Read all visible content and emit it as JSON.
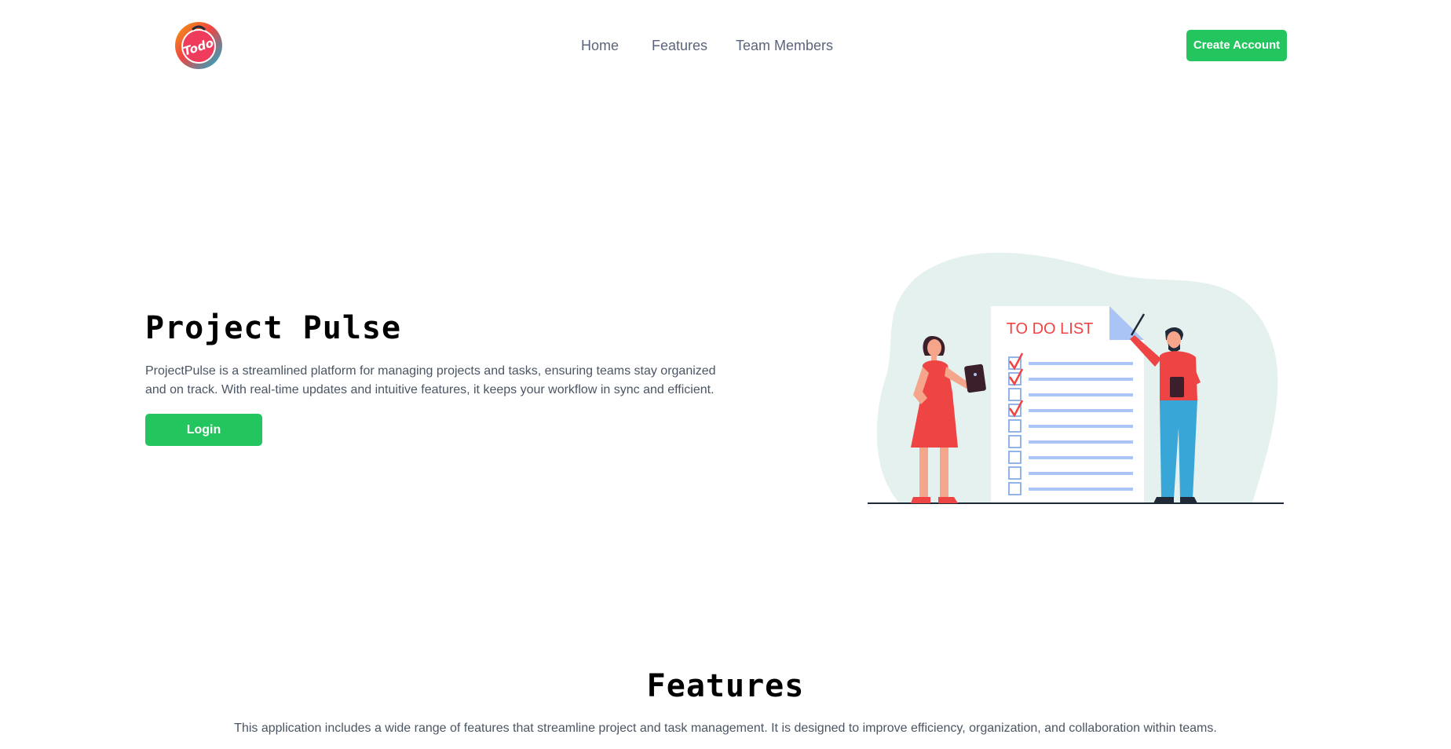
{
  "header": {
    "logo_text": "Todo",
    "nav": [
      {
        "label": "Home"
      },
      {
        "label": "Features"
      },
      {
        "label": "Team Members"
      }
    ],
    "create_account_label": "Create Account"
  },
  "hero": {
    "title": "Project Pulse",
    "description": "ProjectPulse is a streamlined platform for managing projects and tasks, ensuring teams stay organized and on track. With real-time updates and intuitive features, it keeps your workflow in sync and efficient.",
    "login_label": "Login",
    "illustration": {
      "heading": "TO DO LIST",
      "checked_items": 3,
      "total_items": 9
    }
  },
  "features": {
    "title": "Features",
    "description": "This application includes a wide range of features that streamline project and task management. It is designed to improve efficiency, organization, and collaboration within teams."
  },
  "colors": {
    "accent": "#22c55e",
    "nav_text": "#5b6478",
    "body_text": "#4b5563",
    "illustration_red": "#ef4444",
    "illustration_blue": "#60a5fa",
    "illustration_bg": "#e4f1ef"
  }
}
